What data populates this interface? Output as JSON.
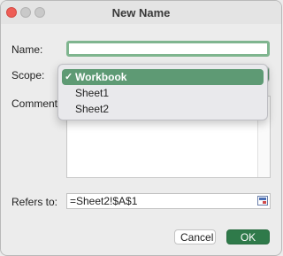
{
  "window": {
    "title": "New Name"
  },
  "form": {
    "name_label": "Name:",
    "name_value": "",
    "scope_label": "Scope:",
    "comment_label": "Comment:",
    "comment_value": "",
    "refers_label": "Refers to:",
    "refers_value": "=Sheet2!$A$1"
  },
  "scope_dropdown": {
    "selected": "Workbook",
    "options": [
      {
        "label": "Workbook",
        "checked": true
      },
      {
        "label": "Sheet1",
        "checked": false
      },
      {
        "label": "Sheet2",
        "checked": false
      }
    ],
    "check_mark": "✓"
  },
  "buttons": {
    "cancel": "Cancel",
    "ok": "OK"
  },
  "colors": {
    "accent_green": "#5e9a74",
    "ok_button": "#2f7a4a",
    "focus_ring": "#7fb58f"
  },
  "icons": {
    "refers_collapse": "collapse-dialog-icon"
  }
}
